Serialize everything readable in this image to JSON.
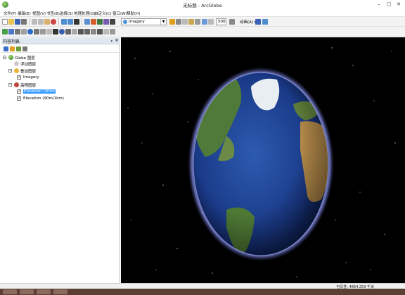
{
  "window": {
    "title": "无标题 - ArcGlobe",
    "minimize": "–",
    "maximize": "□",
    "close": "✕"
  },
  "menu": [
    "文件(F)",
    "编辑(E)",
    "视图(V)",
    "书签(B)",
    "选择(S)",
    "地理处理(G)",
    "自定义(C)",
    "窗口(W)",
    "帮助(H)"
  ],
  "toolbar": {
    "layer_select_value": "Imagery",
    "speed_value": "500",
    "animation_label": "动画(A) ▾"
  },
  "toc": {
    "title": "内容列表",
    "pin": "ᵩ",
    "close": "×",
    "nodes": [
      {
        "label": "Globe 图层",
        "expander": "−"
      },
      {
        "label": "浮动图层"
      },
      {
        "label": "叠加图层",
        "expander": "−"
      },
      {
        "label": "Imagery",
        "checked": "✓"
      },
      {
        "label": "高程图层",
        "expander": "−"
      },
      {
        "label": "Elevation (30m)",
        "checked": "✓"
      },
      {
        "label": "Elevation (90m/1km)",
        "checked": "✓"
      }
    ]
  },
  "status": {
    "text": "可见性:  4864.259 千米"
  },
  "colors": {
    "ocean": "#1d3f8f",
    "land": "#3d6b2a",
    "atmosphere": "#6e77c9",
    "selection": "#3399ff"
  }
}
